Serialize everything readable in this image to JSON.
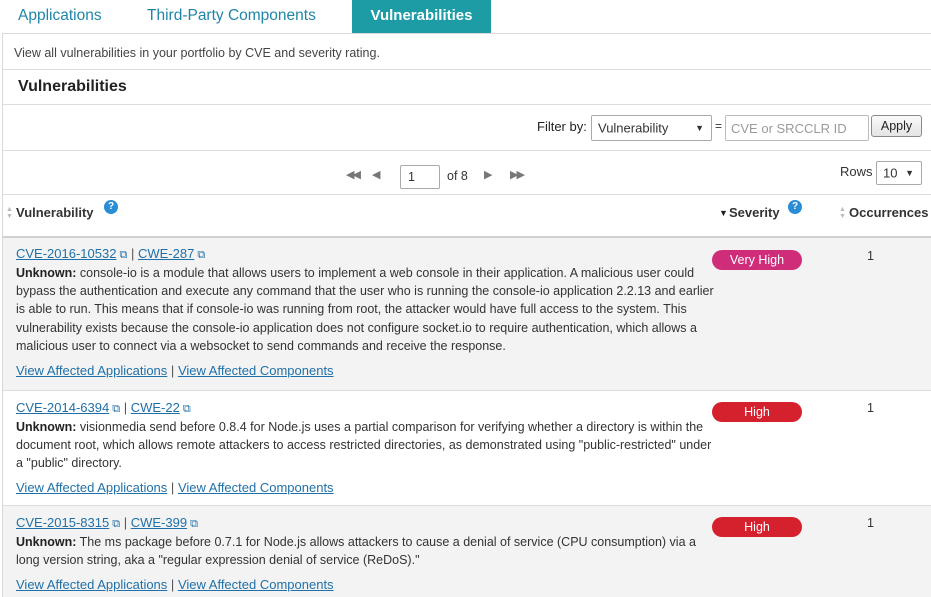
{
  "tabs": [
    {
      "label": "Applications"
    },
    {
      "label": "Third-Party Components"
    },
    {
      "label": "Vulnerabilities"
    }
  ],
  "description": "View all vulnerabilities in your portfolio by CVE and severity rating.",
  "section_title": "Vulnerabilities",
  "filter": {
    "label": "Filter by:",
    "selected": "Vulnerability",
    "equals": "=",
    "placeholder": "CVE or SRCCLR ID",
    "apply_label": "Apply"
  },
  "pager": {
    "page": "1",
    "of_text": "of 8",
    "rows_label": "Rows",
    "rows_value": "10"
  },
  "columns": {
    "vulnerability": "Vulnerability",
    "severity": "Severity",
    "occurrences": "Occurrences",
    "help": "?"
  },
  "rows": [
    {
      "cve": "CVE-2016-10532",
      "cwe": "CWE-287",
      "prefix": "Unknown:",
      "description": "console-io is a module that allows users to implement a web console in their application. A malicious user could bypass the authentication and execute any command that the user who is running the console-io application 2.2.13 and earlier is able to run. This means that if console-io was running from root, the attacker would have full access to the system. This vulnerability exists because the console-io application does not configure socket.io to require authentication, which allows a malicious user to connect via a websocket to send commands and receive the response.",
      "severity": "Very High",
      "occurrences": "1",
      "link_apps": "View Affected Applications",
      "link_sep": "|",
      "link_comps": "View Affected Components"
    },
    {
      "cve": "CVE-2014-6394",
      "cwe": "CWE-22",
      "prefix": "Unknown:",
      "description": "visionmedia send before 0.8.4 for Node.js uses a partial comparison for verifying whether a directory is within the document root, which allows remote attackers to access restricted directories, as demonstrated using \"public-restricted\" under a \"public\" directory.",
      "severity": "High",
      "occurrences": "1",
      "link_apps": "View Affected Applications",
      "link_sep": "|",
      "link_comps": "View Affected Components"
    },
    {
      "cve": "CVE-2015-8315",
      "cwe": "CWE-399",
      "prefix": "Unknown:",
      "description": "The ms package before 0.7.1 for Node.js allows attackers to cause a denial of service (CPU consumption) via a long version string, aka a \"regular expression denial of service (ReDoS).\"",
      "severity": "High",
      "occurrences": "1",
      "link_apps": "View Affected Applications",
      "link_sep": "|",
      "link_comps": "View Affected Components"
    }
  ],
  "colors": {
    "tab_active": "#1e9ca5",
    "link": "#1f70a8",
    "very_high": "#cf2d7a",
    "high": "#d5202d",
    "help": "#2a8ed6"
  },
  "icons": {
    "external_link": "external-link-icon",
    "help": "help-icon",
    "first_page": "first-page-icon",
    "prev_page": "prev-page-icon",
    "next_page": "next-page-icon",
    "last_page": "last-page-icon"
  }
}
